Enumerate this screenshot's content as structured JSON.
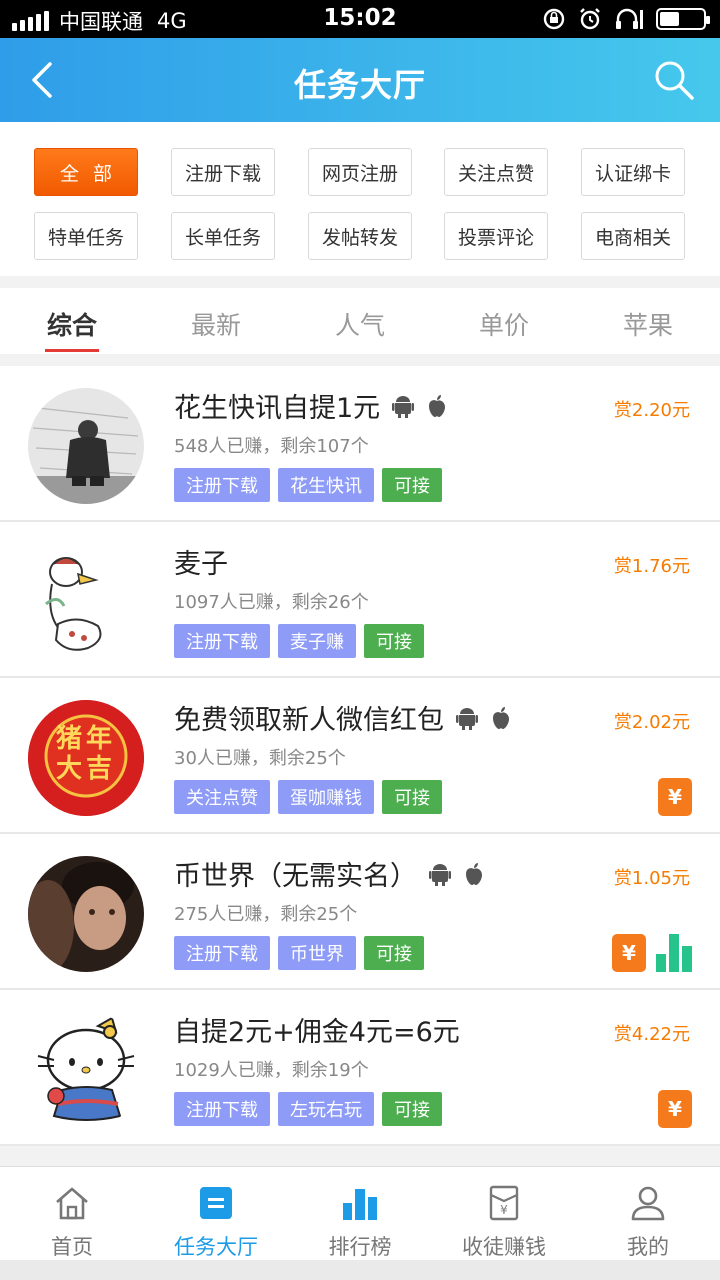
{
  "status_bar": {
    "carrier": "中国联通",
    "network": "4G",
    "time": "15:02",
    "battery_level": 0.45
  },
  "header": {
    "title": "任务大厅",
    "back_icon": "chevron-left-icon",
    "search_icon": "search-icon"
  },
  "categories": [
    {
      "label": "全部",
      "active": true
    },
    {
      "label": "注册下载"
    },
    {
      "label": "网页注册"
    },
    {
      "label": "关注点赞"
    },
    {
      "label": "认证绑卡"
    },
    {
      "label": "特单任务"
    },
    {
      "label": "长单任务"
    },
    {
      "label": "发帖转发"
    },
    {
      "label": "投票评论"
    },
    {
      "label": "电商相关"
    }
  ],
  "sort_tabs": [
    {
      "label": "综合",
      "active": true
    },
    {
      "label": "最新"
    },
    {
      "label": "人气"
    },
    {
      "label": "单价"
    },
    {
      "label": "苹果"
    }
  ],
  "tasks": [
    {
      "title": "花生快讯自提1元",
      "stats": "548人已赚，剩余107个",
      "tags": [
        "注册下载",
        "花生快讯"
      ],
      "status": "可接",
      "reward": "赏2.20元",
      "platforms": [
        "android",
        "apple"
      ]
    },
    {
      "title": "麦子",
      "stats": "1097人已赚，剩余26个",
      "tags": [
        "注册下载",
        "麦子赚"
      ],
      "status": "可接",
      "reward": "赏1.76元",
      "platforms": []
    },
    {
      "title": "免费领取新人微信红包",
      "stats": "30人已赚，剩余25个",
      "tags": [
        "关注点赞",
        "蛋咖赚钱"
      ],
      "status": "可接",
      "reward": "赏2.02元",
      "platforms": [
        "android",
        "apple"
      ],
      "badge_text": "猪年大吉"
    },
    {
      "title": "币世界（无需实名）",
      "stats": "275人已赚，剩余25个",
      "tags": [
        "注册下载",
        "币世界"
      ],
      "status": "可接",
      "reward": "赏1.05元",
      "platforms": [
        "android",
        "apple"
      ]
    },
    {
      "title": "自提2元+佣金4元=6元",
      "stats": "1029人已赚，剩余19个",
      "tags": [
        "注册下载",
        "左玩右玩"
      ],
      "status": "可接",
      "reward": "赏4.22元",
      "platforms": []
    }
  ],
  "yen_symbol": "¥",
  "bottom_nav": [
    {
      "label": "首页",
      "icon": "home-icon"
    },
    {
      "label": "任务大厅",
      "icon": "task-hall-icon",
      "active": true
    },
    {
      "label": "排行榜",
      "icon": "ranking-icon"
    },
    {
      "label": "收徒赚钱",
      "icon": "invite-earn-icon"
    },
    {
      "label": "我的",
      "icon": "profile-icon"
    }
  ],
  "colors": {
    "header_start": "#2f9de9",
    "header_end": "#46c8ec",
    "accent_orange": "#f15a00",
    "tag_blue": "#8e9cf8",
    "tag_green": "#4cae4f",
    "reward": "#f57c00",
    "nav_active": "#1e9be6"
  }
}
